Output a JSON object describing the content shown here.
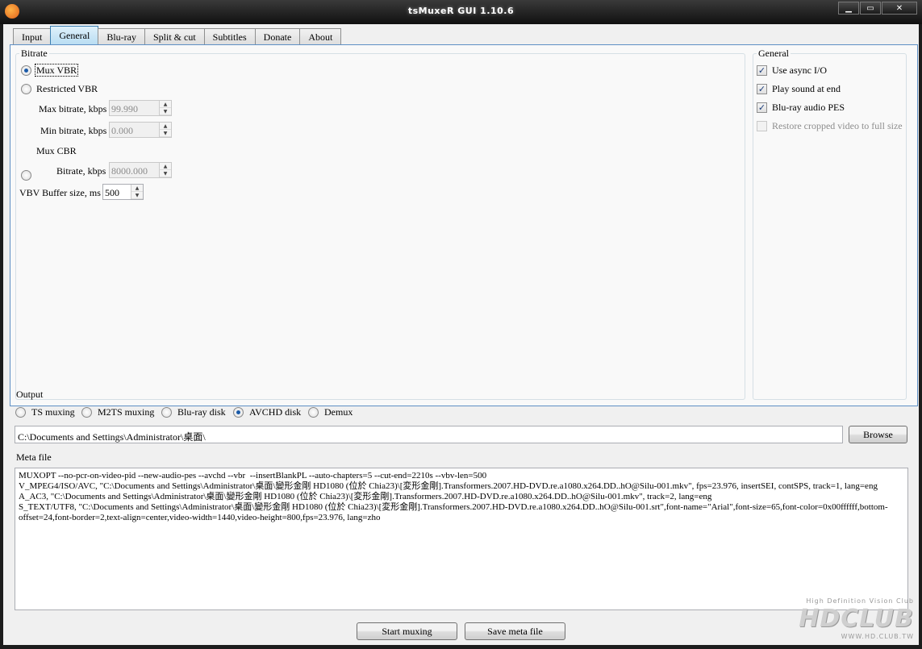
{
  "window": {
    "title": "tsMuxeR GUI 1.10.6",
    "controls": {
      "minimize": "▁",
      "maximize": "▭",
      "close": "✕"
    }
  },
  "tabs": [
    "Input",
    "General",
    "Blu-ray",
    "Split & cut",
    "Subtitles",
    "Donate",
    "About"
  ],
  "active_tab": "General",
  "bitrate": {
    "legend": "Bitrate",
    "mux_vbr": "Mux VBR",
    "restricted_vbr": "Restricted VBR",
    "max_bitrate_label": "Max bitrate, kbps",
    "max_bitrate_value": "99.990",
    "min_bitrate_label": "Min bitrate, kbps",
    "min_bitrate_value": "0.000",
    "mux_cbr": "Mux CBR",
    "cbr_bitrate_label": "Bitrate, kbps",
    "cbr_bitrate_value": "8000.000",
    "vbv_label": "VBV Buffer size, ms",
    "vbv_value": "500",
    "selected": "Mux VBR"
  },
  "general": {
    "legend": "General",
    "options": [
      {
        "label": "Use async I/O",
        "checked": true,
        "enabled": true
      },
      {
        "label": "Play sound at end",
        "checked": true,
        "enabled": true
      },
      {
        "label": "Blu-ray audio PES",
        "checked": true,
        "enabled": true
      },
      {
        "label": "Restore cropped video to full size",
        "checked": false,
        "enabled": false
      }
    ]
  },
  "output": {
    "legend": "Output",
    "modes": [
      "TS muxing",
      "M2TS muxing",
      "Blu-ray disk",
      "AVCHD disk",
      "Demux"
    ],
    "selected": "AVCHD disk",
    "path": "C:\\Documents and Settings\\Administrator\\桌面\\",
    "browse_label": "Browse"
  },
  "meta": {
    "legend": "Meta file",
    "content": "MUXOPT --no-pcr-on-video-pid --new-audio-pes --avchd --vbr  --insertBlankPL --auto-chapters=5 --cut-end=2210s --vbv-len=500\nV_MPEG4/ISO/AVC, \"C:\\Documents and Settings\\Administrator\\桌面\\變形金剛 HD1080 (位於 Chia23)\\[変形金剛].Transformers.2007.HD-DVD.re.a1080.x264.DD..hO@Silu-001.mkv\", fps=23.976, insertSEI, contSPS, track=1, lang=eng\nA_AC3, \"C:\\Documents and Settings\\Administrator\\桌面\\變形金剛 HD1080 (位於 Chia23)\\[変形金剛].Transformers.2007.HD-DVD.re.a1080.x264.DD..hO@Silu-001.mkv\", track=2, lang=eng\nS_TEXT/UTF8, \"C:\\Documents and Settings\\Administrator\\桌面\\變形金剛 HD1080 (位於 Chia23)\\[変形金剛].Transformers.2007.HD-DVD.re.a1080.x264.DD..hO@Silu-001.srt\",font-name=\"Arial\",font-size=65,font-color=0x00ffffff,bottom-offset=24,font-border=2,text-align=center,video-width=1440,video-height=800,fps=23.976, lang=zho"
  },
  "actions": {
    "start_muxing": "Start muxing",
    "save_meta": "Save meta file"
  },
  "watermark": {
    "logo": "HDCLUB",
    "tagline": "High Definition Vision Club",
    "url": "WWW.HD.CLUB.TW"
  },
  "colors": {
    "titlebar": "#1c1c1c",
    "active_tab": "#b7dcf2",
    "panel_border": "#5e8fc4",
    "radio_dot": "#1a5aa8"
  }
}
